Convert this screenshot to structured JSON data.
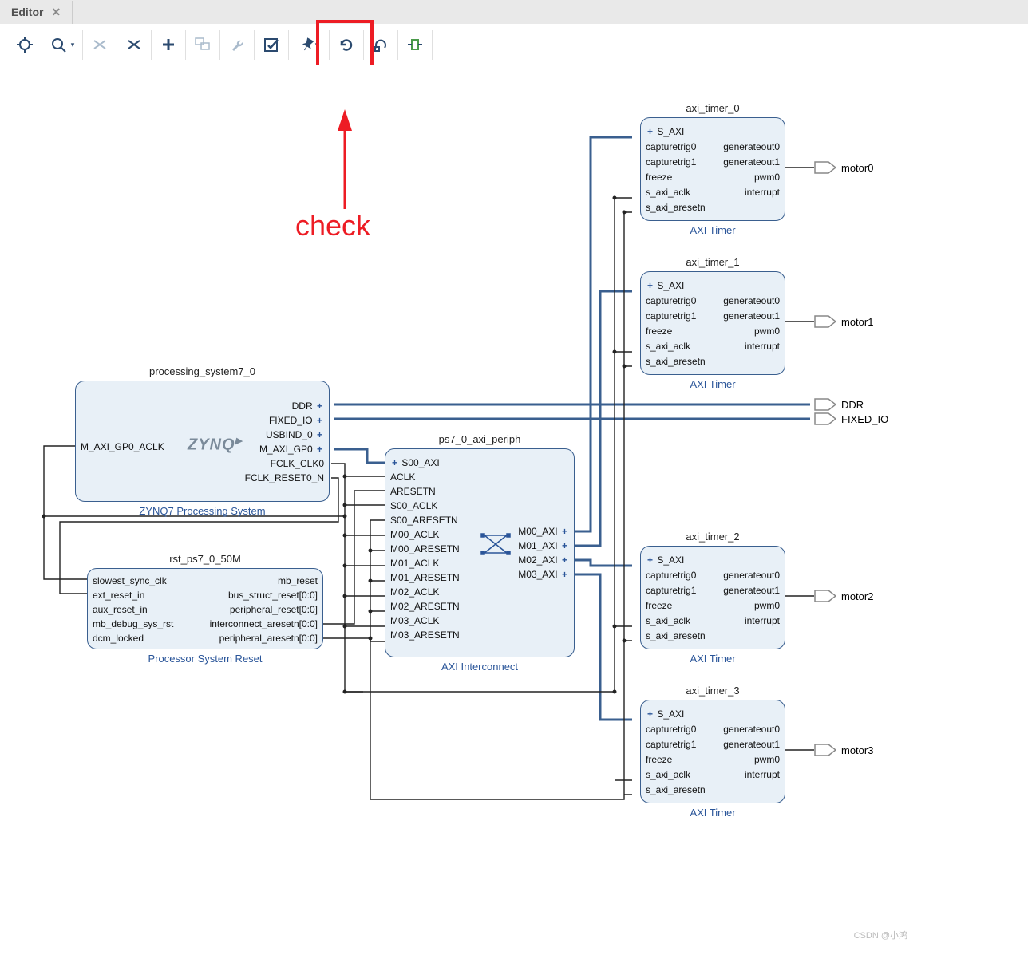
{
  "tab": {
    "title": "Editor"
  },
  "toolbar": {
    "icons": [
      "target",
      "zoom",
      "fit-h",
      "fit-v",
      "add",
      "group",
      "wrench",
      "check",
      "pin",
      "refresh",
      "rotate",
      "expand"
    ]
  },
  "annotation": {
    "text": "check"
  },
  "watermark": "CSDN @小鸿",
  "external_ports": {
    "ddr": "DDR",
    "fixed_io": "FIXED_IO",
    "motor0": "motor0",
    "motor1": "motor1",
    "motor2": "motor2",
    "motor3": "motor3"
  },
  "blocks": {
    "ps7": {
      "instance": "processing_system7_0",
      "type": "ZYNQ7 Processing System",
      "logo": "ZYNQ",
      "left_ports": [
        "M_AXI_GP0_ACLK"
      ],
      "right_ports": [
        "DDR",
        "FIXED_IO",
        "USBIND_0",
        "M_AXI_GP0",
        "FCLK_CLK0",
        "FCLK_RESET0_N"
      ]
    },
    "rst": {
      "instance": "rst_ps7_0_50M",
      "type": "Processor System Reset",
      "left_ports": [
        "slowest_sync_clk",
        "ext_reset_in",
        "aux_reset_in",
        "mb_debug_sys_rst",
        "dcm_locked"
      ],
      "right_ports": [
        "mb_reset",
        "bus_struct_reset[0:0]",
        "peripheral_reset[0:0]",
        "interconnect_aresetn[0:0]",
        "peripheral_aresetn[0:0]"
      ]
    },
    "axi": {
      "instance": "ps7_0_axi_periph",
      "type": "AXI Interconnect",
      "left_ports": [
        "S00_AXI",
        "ACLK",
        "ARESETN",
        "S00_ACLK",
        "S00_ARESETN",
        "M00_ACLK",
        "M00_ARESETN",
        "M01_ACLK",
        "M01_ARESETN",
        "M02_ACLK",
        "M02_ARESETN",
        "M03_ACLK",
        "M03_ARESETN"
      ],
      "right_ports": [
        "M00_AXI",
        "M01_AXI",
        "M02_AXI",
        "M03_AXI"
      ]
    },
    "timer": {
      "type": "AXI Timer",
      "left_ports": [
        "S_AXI",
        "capturetrig0",
        "capturetrig1",
        "freeze",
        "s_axi_aclk",
        "s_axi_aresetn"
      ],
      "right_ports": [
        "generateout0",
        "generateout1",
        "pwm0",
        "interrupt"
      ],
      "instances": [
        "axi_timer_0",
        "axi_timer_1",
        "axi_timer_2",
        "axi_timer_3"
      ]
    }
  }
}
